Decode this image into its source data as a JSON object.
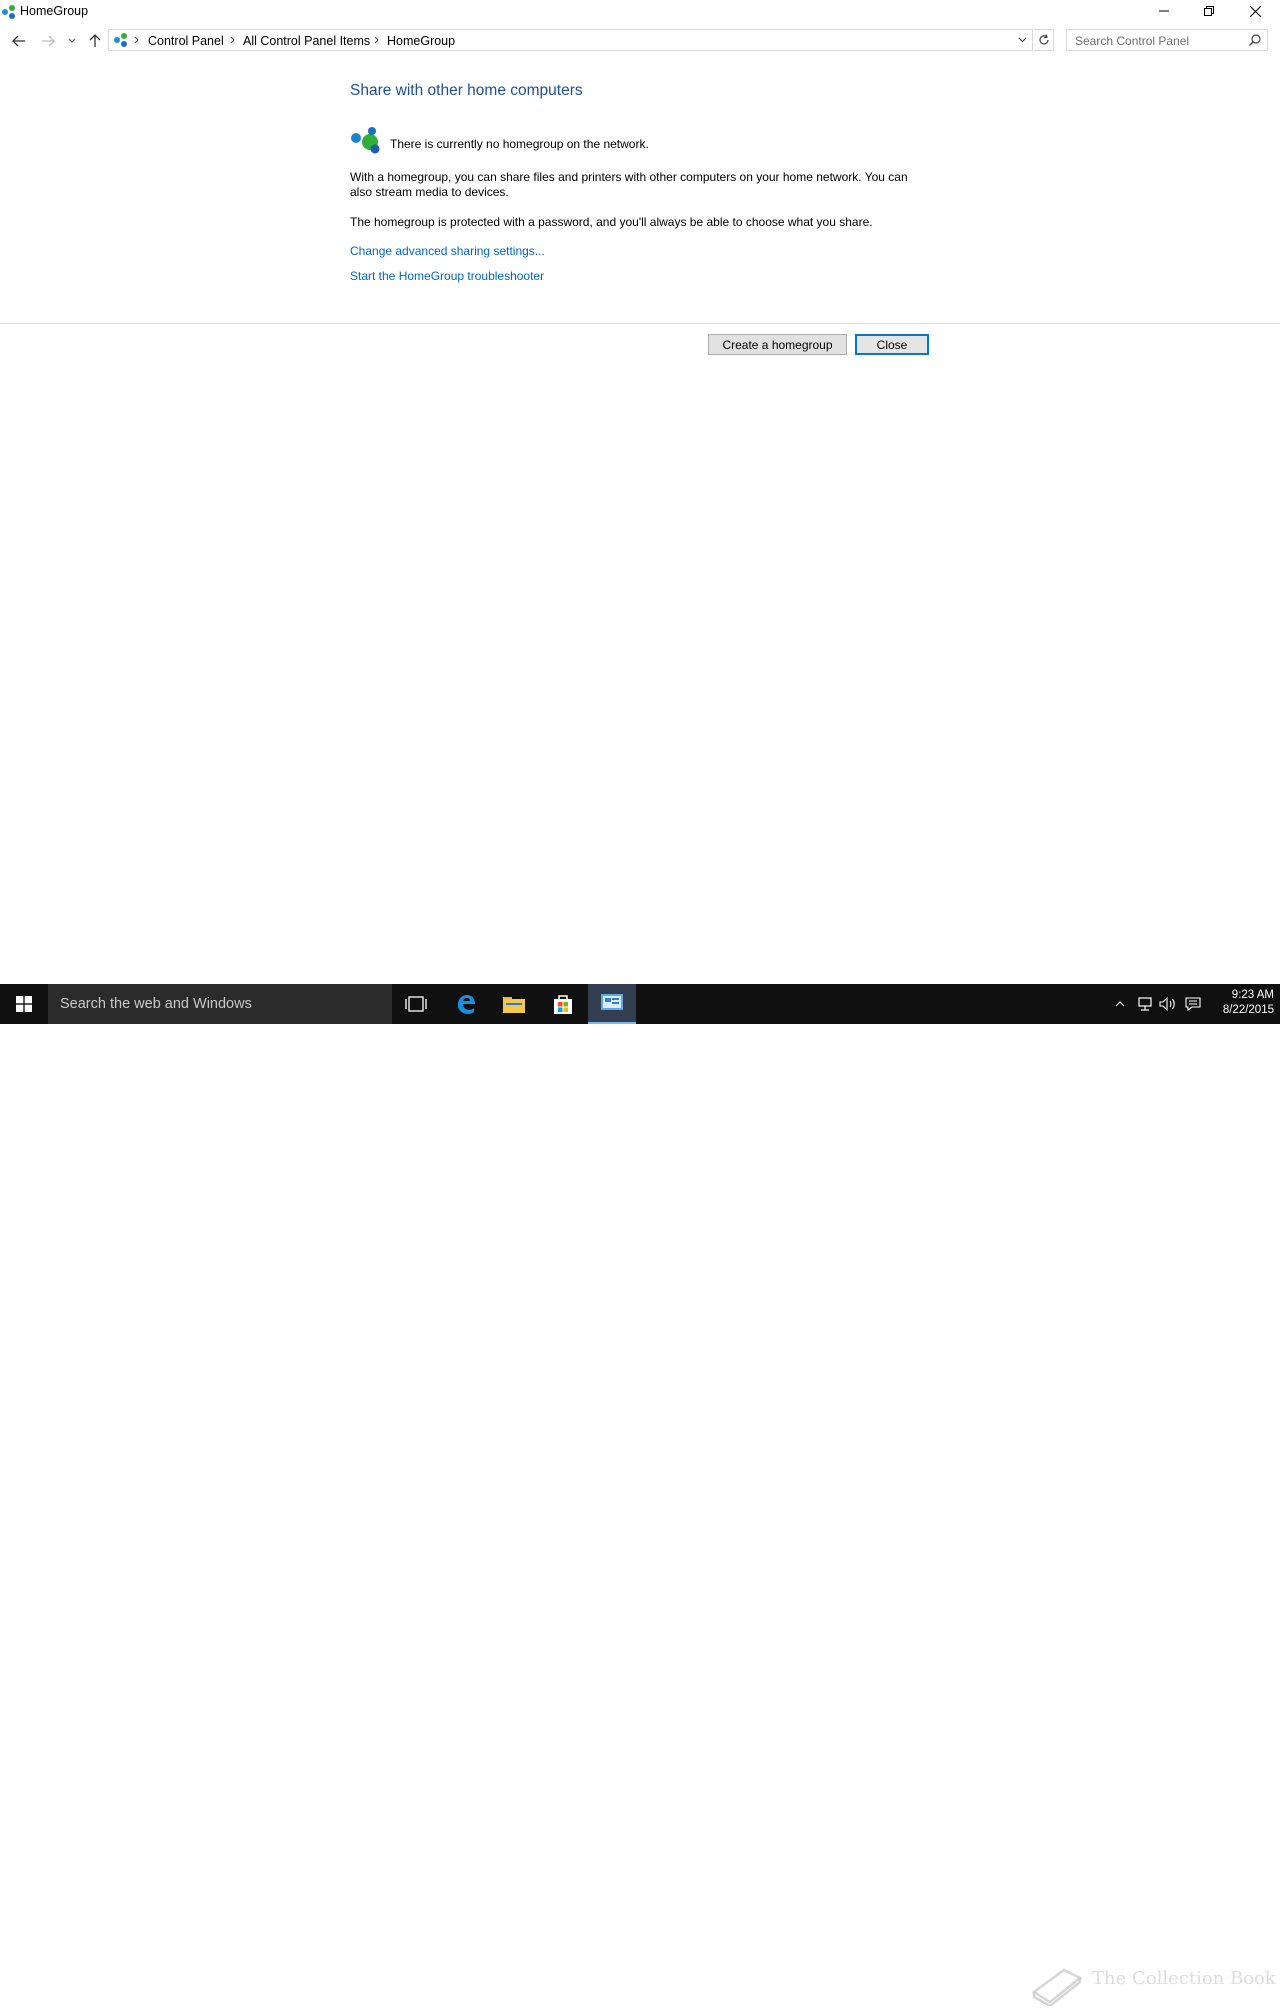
{
  "window": {
    "title": "HomeGroup",
    "controls": {
      "minimize": "minimize",
      "restore": "restore",
      "close": "close"
    }
  },
  "nav": {
    "breadcrumbs": [
      "Control Panel",
      "All Control Panel Items",
      "HomeGroup"
    ],
    "search_placeholder": "Search Control Panel"
  },
  "content": {
    "heading": "Share with other home computers",
    "status": "There is currently no homegroup on the network.",
    "para1": "With a homegroup, you can share files and printers with other computers on your home network. You can also stream media to devices.",
    "para2": "The homegroup is protected with a password, and you'll always be able to choose what you share.",
    "link1": "Change advanced sharing settings...",
    "link2": "Start the HomeGroup troubleshooter"
  },
  "buttons": {
    "create": "Create a homegroup",
    "close": "Close"
  },
  "taskbar": {
    "search_text": "Search the web and Windows",
    "time": "9:23 AM",
    "date": "8/22/2015",
    "watermark": "The Collection Book"
  },
  "colors": {
    "heading": "#1f4e9a",
    "link": "#0066cc",
    "taskbar": "#101010",
    "accent": "#0078d7"
  }
}
